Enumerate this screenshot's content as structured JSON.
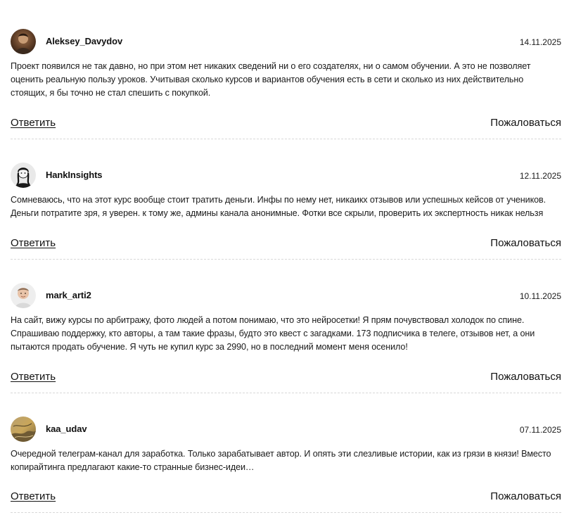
{
  "reviews": [
    {
      "author": "Aleksey_Davydov",
      "date": "14.11.2025",
      "avatar_icon": "user-photo-icon",
      "text": "Проект появился не так давно, но при этом нет никаких сведений ни о его создателях, ни о самом обучении. А это не позволяет оценить реальную пользу уроков. Учитывая сколько курсов и вариантов обучения есть в сети и сколько из них действительно стоящих, я бы точно не стал спешить с покупкой.",
      "reply_label": "Ответить",
      "report_label": "Пожаловаться"
    },
    {
      "author": "HankInsights",
      "date": "12.11.2025",
      "avatar_icon": "user-photo-icon",
      "text": "Сомневаюсь, что на этот курс вообще стоит тратить деньги. Инфы по нему нет, никаикх отзывов или успешных кейсов от учеников. Деньги потратите зря, я уверен. к тому же, админы канала анонимные. Фотки все скрыли, проверить их экспертность никак нельзя",
      "reply_label": "Ответить",
      "report_label": "Пожаловаться"
    },
    {
      "author": "mark_arti2",
      "date": "10.11.2025",
      "avatar_icon": "user-photo-icon",
      "text": "На сайт, вижу курсы по арбитражу, фото людей а потом понимаю, что это нейросетки! Я прям почувствовал холодок по спине. Спрашиваю поддержку, кто авторы, а там такие фразы, будто это квест с загадками. 173 подписчика в телеге, отзывов нет, а они пытаются продать обучение. Я чуть не купил курс за 2990, но в последний момент меня осенило!",
      "reply_label": "Ответить",
      "report_label": "Пожаловаться"
    },
    {
      "author": "kaa_udav",
      "date": "07.11.2025",
      "avatar_icon": "user-photo-icon",
      "text": "Очередной телеграм-канал для заработка. Только зарабатывает автор. И опять эти слезливые истории, как из грязи в князи! Вместо копирайтинга предлагают какие-то странные бизнес-идеи…",
      "reply_label": "Ответить",
      "report_label": "Пожаловаться"
    }
  ]
}
